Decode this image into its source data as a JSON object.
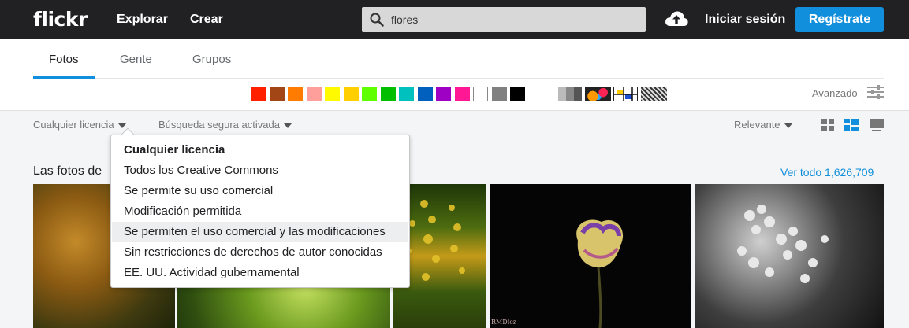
{
  "header": {
    "logo": "flickr",
    "nav": [
      "Explorar",
      "Crear"
    ],
    "search_value": "flores",
    "signin": "Iniciar sesión",
    "signup": "Regístrate"
  },
  "tabs": [
    "Fotos",
    "Gente",
    "Grupos"
  ],
  "active_tab": "Fotos",
  "colors": {
    "swatches": [
      "#ff2000",
      "#a24615",
      "#ff7c00",
      "#ff9f9c",
      "#fffa00",
      "#ffcf00",
      "#5fff00",
      "#01be00",
      "#01c1bf",
      "#015fbe",
      "#9e00c4",
      "#ff1794",
      "#ffffff",
      "#808080",
      "#000000"
    ],
    "accent": "#128fdc"
  },
  "advanced_label": "Avanzado",
  "filters": {
    "license": "Cualquier licencia",
    "safe_search": "Búsqueda segura activada",
    "sort": "Relevante"
  },
  "section": {
    "title": "Las fotos de",
    "see_all": "Ver todo 1,626,709"
  },
  "photo4_signature": "RMDiez",
  "license_menu": [
    "Cualquier licencia",
    "Todos los Creative Commons",
    "Se permite su uso comercial",
    "Modificación permitida",
    "Se permiten el uso comercial y las modificaciones",
    "Sin restricciones de derechos de autor conocidas",
    "EE. UU. Actividad gubernamental"
  ]
}
